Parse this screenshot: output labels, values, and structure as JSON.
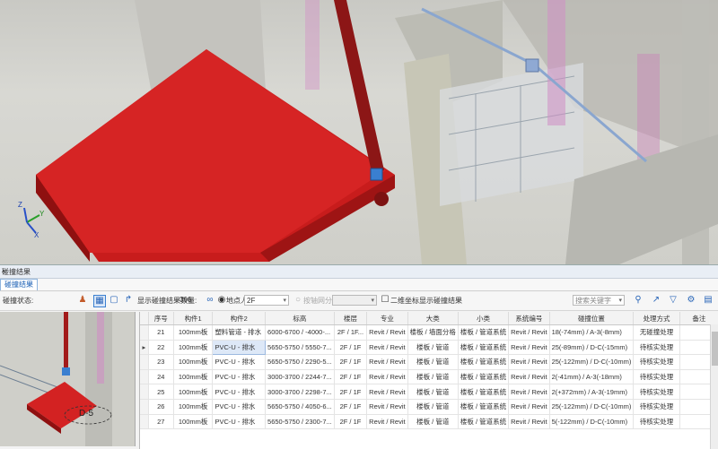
{
  "viewport": {
    "axis": {
      "x": "X",
      "y": "Y",
      "z": "Z"
    }
  },
  "panel": {
    "title": "碰撞结果",
    "tab": "碰撞结果",
    "close_glyph": "×"
  },
  "toolbar": {
    "label_left": "碰撞状态:",
    "count_label": "显示碰撞结果数量:",
    "count_value": "306",
    "radio1_label": "地点人",
    "radio1_select_value": "2F",
    "radio2_label": "按轴网分区",
    "checkbox_label": "二维坐标显示碰撞结果",
    "search_placeholder": "搜索关键字"
  },
  "thumbnail": {
    "label": "D-5"
  },
  "table": {
    "columns": [
      "序号",
      "构件1",
      "构件2",
      "标高",
      "楼层",
      "专业",
      "大类",
      "小类",
      "系统编号",
      "碰撞位置",
      "处理方式",
      "备注"
    ],
    "rows": [
      [
        "21",
        "100mm板",
        "塑料管道 - 排水",
        "6000-6700 / -4000-...",
        "2F / 1F...",
        "Revit / Revit",
        "楼板 / 墙面分格",
        "楼板 / 管道系统",
        "Revit / Revit",
        "18(-74mm) / A-3(-8mm)",
        "无碰撞处理",
        ""
      ],
      [
        "22",
        "100mm板",
        "PVC-U - 排水",
        "5650-5750 / 5550-7...",
        "2F / 1F",
        "Revit / Revit",
        "楼板 / 管道",
        "楼板 / 管道系统",
        "Revit / Revit",
        "25(-89mm) / D-C(-15mm)",
        "待核实处理",
        ""
      ],
      [
        "23",
        "100mm板",
        "PVC-U - 排水",
        "5650-5750 / 2290-5...",
        "2F / 1F",
        "Revit / Revit",
        "楼板 / 管道",
        "楼板 / 管道系统",
        "Revit / Revit",
        "25(-122mm) / D-C(-10mm)",
        "待核实处理",
        ""
      ],
      [
        "24",
        "100mm板",
        "PVC-U - 排水",
        "3000-3700 / 2244-7...",
        "2F / 1F",
        "Revit / Revit",
        "楼板 / 管道",
        "楼板 / 管道系统",
        "Revit / Revit",
        "2(-41mm) / A-3(-18mm)",
        "待核实处理",
        ""
      ],
      [
        "25",
        "100mm板",
        "PVC-U - 排水",
        "3000-3700 / 2298-7...",
        "2F / 1F",
        "Revit / Revit",
        "楼板 / 管道",
        "楼板 / 管道系统",
        "Revit / Revit",
        "2(+372mm) / A-3(-19mm)",
        "待核实处理",
        ""
      ],
      [
        "26",
        "100mm板",
        "PVC-U - 排水",
        "5650-5750 / 4050-6...",
        "2F / 1F",
        "Revit / Revit",
        "楼板 / 管道",
        "楼板 / 管道系统",
        "Revit / Revit",
        "25(-122mm) / D-C(-10mm)",
        "待核实处理",
        ""
      ],
      [
        "27",
        "100mm板",
        "PVC-U - 排水",
        "5650-5750 / 2300-7...",
        "2F / 1F",
        "Revit / Revit",
        "楼板 / 管道",
        "楼板 / 管道系统",
        "Revit / Revit",
        "5(-122mm) / D-C(-10mm)",
        "待核实处理",
        ""
      ]
    ],
    "selected_row": 1
  }
}
